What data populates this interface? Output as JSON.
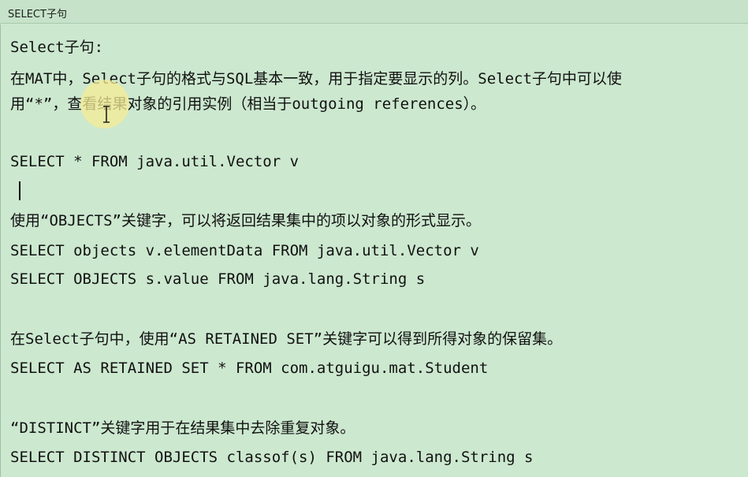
{
  "window": {
    "title": "SELECT子句"
  },
  "lines": [
    "Select子句:",
    "在MAT中，Select子句的格式与SQL基本一致，用于指定要显示的列。Select子句中可以使",
    "用“*”，查看结果对象的引用实例（相当于outgoing references）。",
    "SELECT * FROM java.util.Vector v",
    "使用“OBJECTS”关键字，可以将返回结果集中的项以对象的形式显示。",
    "SELECT objects v.elementData FROM java.util.Vector v",
    "SELECT OBJECTS s.value FROM java.lang.String s",
    "在Select子句中，使用“AS RETAINED SET”关键字可以得到所得对象的保留集。",
    "SELECT AS RETAINED SET * FROM com.atguigu.mat.Student",
    "“DISTINCT”关键字用于在结果集中去除重复对象。",
    "SELECT DISTINCT OBJECTS classof(s) FROM java.lang.String s"
  ],
  "icons": {
    "pointer": "text-cursor-icon",
    "highlight": "mouse-highlight-icon",
    "caret": "text-caret"
  }
}
